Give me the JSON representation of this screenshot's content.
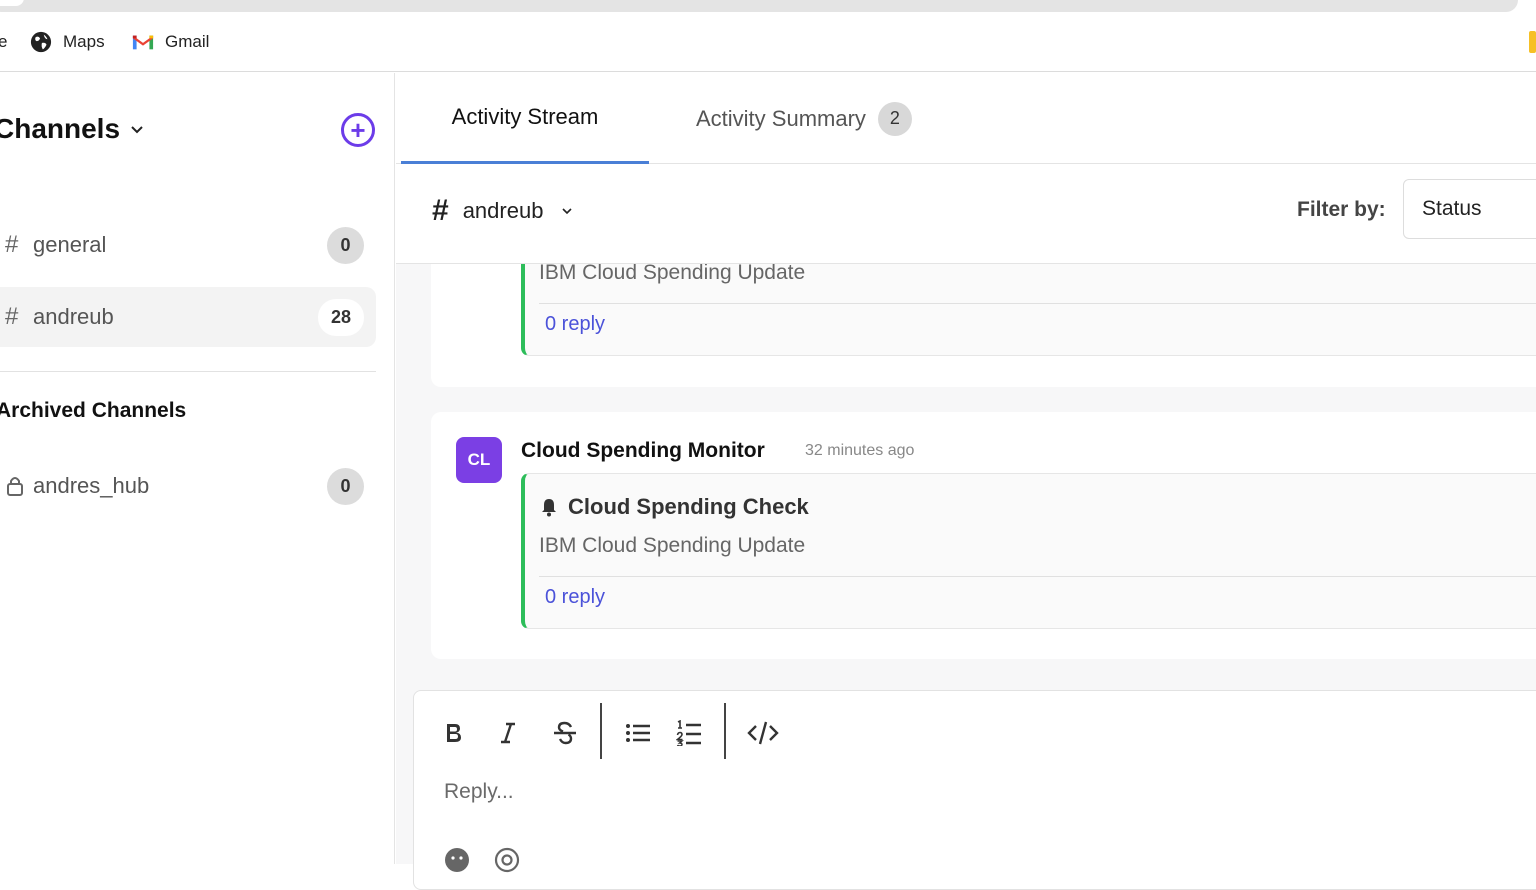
{
  "browser": {
    "bookmarks": [
      {
        "label": "e",
        "icon": "none"
      },
      {
        "label": "Maps",
        "icon": "globe-icon"
      },
      {
        "label": "Gmail",
        "icon": "gmail-icon"
      }
    ]
  },
  "sidebar": {
    "title": "Channels",
    "add_icon": "+",
    "channels": [
      {
        "name": "general",
        "count": "0"
      },
      {
        "name": "andreub",
        "count": "28"
      }
    ],
    "archived_title": "Archived Channels",
    "archived": [
      {
        "name": "andres_hub",
        "count": "0"
      }
    ]
  },
  "main": {
    "tabs": [
      {
        "label": "Activity Stream"
      },
      {
        "label": "Activity Summary",
        "badge": "2"
      }
    ],
    "channel_selector": {
      "hash": "#",
      "name": "andreub"
    },
    "filter": {
      "label": "Filter by:",
      "value": "Status"
    },
    "feed": [
      {
        "desc": "IBM Cloud Spending Update",
        "reply": "0 reply"
      },
      {
        "avatar": "CL",
        "author": "Cloud Spending Monitor",
        "time": "32 minutes ago",
        "title": "Cloud Spending Check",
        "desc": "IBM Cloud Spending Update",
        "reply": "0 reply"
      }
    ],
    "composer": {
      "placeholder": "Reply..."
    }
  },
  "colors": {
    "accent": "#6c3ce9",
    "tab_underline": "#4a7fd6",
    "status_border": "#2dbd5a",
    "link": "#4b52d9",
    "avatar_bg": "#7b3fe4"
  }
}
